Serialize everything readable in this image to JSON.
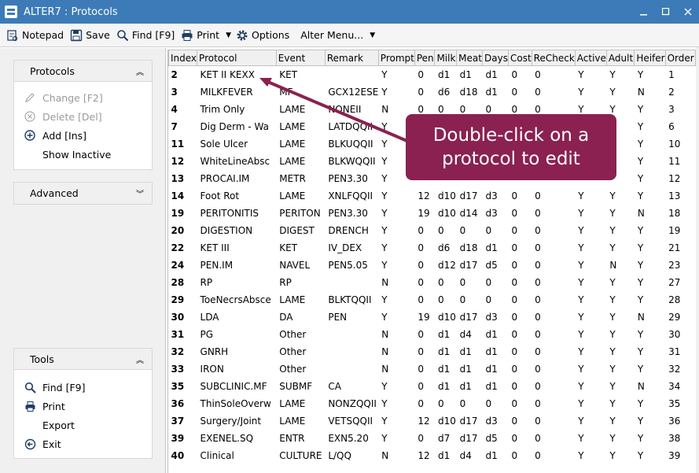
{
  "window": {
    "title": "ALTER7 : Protocols"
  },
  "toolbar": {
    "notepad": "Notepad",
    "save": "Save",
    "find": "Find [F9]",
    "print": "Print",
    "options": "Options",
    "alter_menu": "Alter Menu..."
  },
  "sidebar": {
    "protocols": {
      "title": "Protocols",
      "change": "Change [F2]",
      "delete": "Delete [Del]",
      "add": "Add [Ins]",
      "show_inactive": "Show Inactive"
    },
    "advanced": {
      "title": "Advanced"
    },
    "tools": {
      "title": "Tools",
      "find": "Find [F9]",
      "print": "Print",
      "export": "Export",
      "exit": "Exit"
    }
  },
  "grid": {
    "columns": [
      "Index",
      "Protocol",
      "Event",
      "Remark",
      "Prompt",
      "Pen",
      "Milk",
      "Meat",
      "Days",
      "Cost",
      "ReCheck",
      "Active",
      "Adult",
      "Heifer",
      "Order"
    ],
    "rows": [
      [
        "2",
        "KET II KEXX",
        "KET",
        "",
        "Y",
        "0",
        "d1",
        "d1",
        "d1",
        "0",
        "0",
        "Y",
        "Y",
        "Y",
        "1"
      ],
      [
        "3",
        "MILKFEVER",
        "MF",
        "GCX12ESE",
        "Y",
        "0",
        "d6",
        "d18",
        "d1",
        "0",
        "0",
        "Y",
        "Y",
        "N",
        "2"
      ],
      [
        "4",
        "Trim Only",
        "LAME",
        "NONEII",
        "N",
        "0",
        "0",
        "0",
        "0",
        "0",
        "0",
        "Y",
        "Y",
        "Y",
        "3"
      ],
      [
        "7",
        "Dig Derm - Wa",
        "LAME",
        "LATDQQII",
        "Y",
        "",
        "",
        "",
        "",
        "",
        "",
        "",
        "",
        "Y",
        "6"
      ],
      [
        "11",
        "Sole Ulcer",
        "LAME",
        "BLKUQQII",
        "Y",
        "",
        "",
        "",
        "",
        "",
        "",
        "",
        "",
        "Y",
        "10"
      ],
      [
        "12",
        "WhiteLineAbsc",
        "LAME",
        "BLKWQQII",
        "Y",
        "",
        "",
        "",
        "",
        "",
        "",
        "",
        "",
        "Y",
        "11"
      ],
      [
        "13",
        "PROCAI.IM",
        "METR",
        "PEN3.30",
        "Y",
        "",
        "",
        "",
        "",
        "",
        "",
        "",
        "",
        "Y",
        "12"
      ],
      [
        "14",
        "Foot Rot",
        "LAME",
        "XNLFQQII",
        "Y",
        "12",
        "d10",
        "d17",
        "d3",
        "0",
        "0",
        "Y",
        "Y",
        "Y",
        "13"
      ],
      [
        "19",
        "PERITONITIS",
        "PERITON",
        "PEN3.30",
        "Y",
        "19",
        "d10",
        "d14",
        "d3",
        "0",
        "0",
        "Y",
        "Y",
        "N",
        "18"
      ],
      [
        "20",
        "DIGESTION",
        "DIGEST",
        "DRENCH",
        "Y",
        "0",
        "0",
        "0",
        "0",
        "0",
        "0",
        "Y",
        "Y",
        "Y",
        "19"
      ],
      [
        "22",
        "KET III",
        "KET",
        "IV_DEX",
        "Y",
        "0",
        "d6",
        "d18",
        "d1",
        "0",
        "0",
        "Y",
        "Y",
        "Y",
        "21"
      ],
      [
        "24",
        "PEN.IM",
        "NAVEL",
        "PEN5.05",
        "Y",
        "0",
        "d12",
        "d17",
        "d5",
        "0",
        "0",
        "Y",
        "N",
        "Y",
        "23"
      ],
      [
        "28",
        "RP",
        "RP",
        "",
        "N",
        "0",
        "0",
        "0",
        "0",
        "0",
        "0",
        "Y",
        "Y",
        "Y",
        "27"
      ],
      [
        "29",
        "ToeNecrsAbsce",
        "LAME",
        "BLKTQQII",
        "Y",
        "0",
        "0",
        "0",
        "0",
        "0",
        "0",
        "Y",
        "Y",
        "Y",
        "28"
      ],
      [
        "30",
        "LDA",
        "DA",
        "PEN",
        "Y",
        "19",
        "d10",
        "d17",
        "d3",
        "0",
        "0",
        "Y",
        "Y",
        "N",
        "29"
      ],
      [
        "31",
        "PG",
        "Other",
        "",
        "N",
        "0",
        "d1",
        "d4",
        "d1",
        "0",
        "0",
        "Y",
        "Y",
        "Y",
        "30"
      ],
      [
        "32",
        "GNRH",
        "Other",
        "",
        "N",
        "0",
        "d1",
        "d1",
        "d1",
        "0",
        "0",
        "Y",
        "Y",
        "Y",
        "31"
      ],
      [
        "33",
        "IRON",
        "Other",
        "",
        "N",
        "0",
        "d1",
        "d1",
        "d1",
        "0",
        "0",
        "Y",
        "Y",
        "Y",
        "32"
      ],
      [
        "35",
        "SUBCLINIC.MF",
        "SUBMF",
        "CA",
        "Y",
        "0",
        "d1",
        "d1",
        "d1",
        "0",
        "0",
        "Y",
        "Y",
        "N",
        "34"
      ],
      [
        "36",
        "ThinSoleOverw",
        "LAME",
        "NONZQQII",
        "Y",
        "0",
        "0",
        "0",
        "0",
        "0",
        "0",
        "Y",
        "Y",
        "Y",
        "35"
      ],
      [
        "37",
        "Surgery/Joint",
        "LAME",
        "VETSQQII",
        "Y",
        "12",
        "d10",
        "d17",
        "d3",
        "0",
        "0",
        "Y",
        "Y",
        "Y",
        "36"
      ],
      [
        "39",
        "EXENEL.SQ",
        "ENTR",
        "EXN5.20",
        "Y",
        "0",
        "d7",
        "d17",
        "d5",
        "0",
        "0",
        "Y",
        "Y",
        "Y",
        "38"
      ],
      [
        "40",
        "Clinical",
        "CULTURE",
        "L/QQ",
        "N",
        "12",
        "d1",
        "d4",
        "d1",
        "0",
        "0",
        "Y",
        "Y",
        "Y",
        "39"
      ]
    ]
  },
  "callout": {
    "text": "Double-click on a protocol to edit"
  },
  "colors": {
    "titlebar": "#3c7bb7",
    "callout": "#8a2151"
  }
}
